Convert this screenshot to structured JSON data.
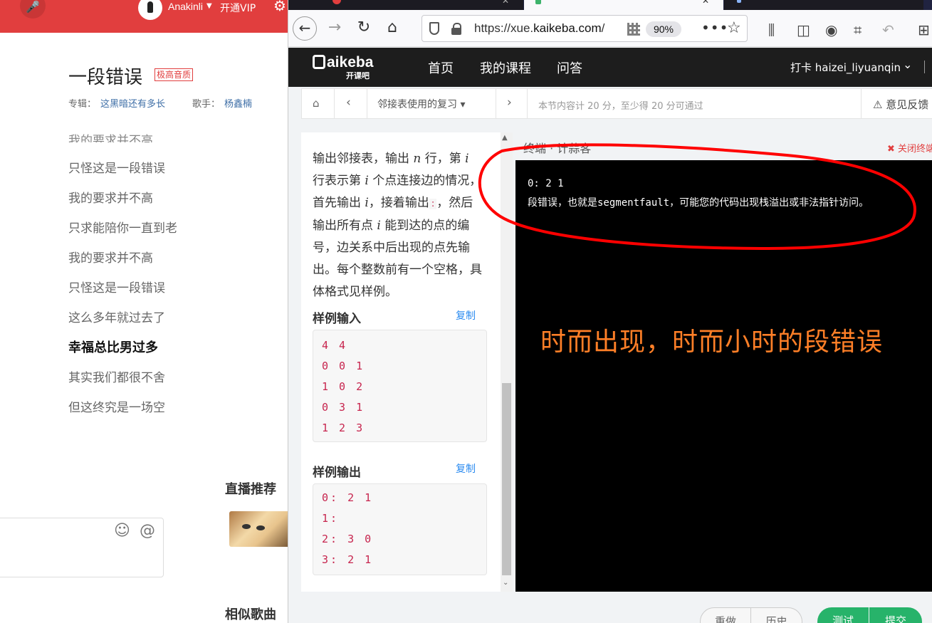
{
  "music": {
    "user_name": "Anakinli",
    "vip_label": "开通VIP",
    "song_title": "一段错误",
    "quality_badge": "极高音质",
    "album_label": "专辑：",
    "album_name": "这黑暗还有多长",
    "singer_label": "歌手：",
    "singer_name": "杨鑫楠",
    "lyric_partial": "我的要求并不高",
    "lyrics": [
      "只怪这是一段错误",
      "我的要求并不高",
      "只求能陪你一直到老",
      "我的要求并不高",
      "只怪这是一段错误",
      "这么多年就过去了",
      "幸福总比男过多",
      "其实我们都很不舍",
      "但这终究是一场空"
    ],
    "active_lyric_index": 6,
    "live_title": "直播推荐",
    "similar_title": "相似歌曲"
  },
  "browser": {
    "url_prefix": "https://xue.",
    "url_domain": "kaikeba.com",
    "url_suffix": "/",
    "zoom": "90%"
  },
  "site": {
    "logo": "aikeba",
    "logo_sub": "开课吧",
    "nav": [
      "首页",
      "我的课程",
      "问答"
    ],
    "checkin": "打卡 haizei_liyuanqin",
    "crumb_title": "邻接表使用的复习",
    "crumb_note": "本节内容计 20 分，至少得 20 分可通过",
    "feedback": "意见反馈"
  },
  "problem": {
    "desc_1": "输出邻接表，输出",
    "var_n": "n",
    "desc_2": "行，第",
    "var_i1": "i",
    "desc_3": "行表示第",
    "var_i2": "i",
    "desc_4": "个点连接边的情况，首先输出",
    "var_i3": "i",
    "desc_5": "，接着输出",
    "colon": ":",
    "desc_6": "，然后输出所有点",
    "var_i4": "i",
    "desc_7": "能到达的点的编号，边关系中后出现的点先输出。每个整数前有一个空格，具体格式见样例。",
    "sample_input_label": "样例输入",
    "sample_output_label": "样例输出",
    "copy_label": "复制",
    "sample_input": [
      "4 4",
      "0 0 1",
      "1 0 2",
      "0 3 1",
      "1 2 3"
    ],
    "sample_output": [
      "0: 2 1",
      "1:",
      "2: 3 0",
      "3: 2 1"
    ]
  },
  "terminal": {
    "tab_label": "终端",
    "tab_label_2": "计蒜客",
    "close_label": "关闭终端",
    "line_1": "0: 2 1",
    "line_2": "段错误，也就是segmentfault，可能您的代码出现栈溢出或非法指针访问。",
    "annotation": "时而出现，时而小时的段错误",
    "annotation_color": "#ff7f27",
    "circle_color": "#ff0000"
  },
  "actions": {
    "redo": "重做",
    "history": "历史",
    "test": "测试",
    "submit": "提交"
  }
}
